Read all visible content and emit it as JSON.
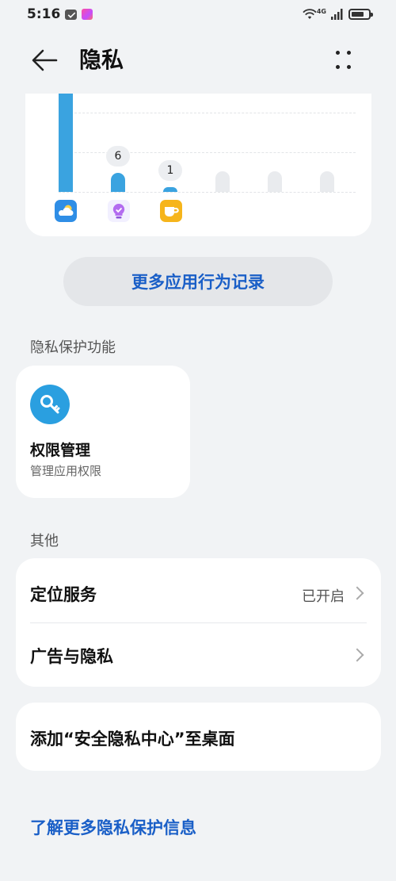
{
  "status_bar": {
    "time": "5:16",
    "network_label": "4G",
    "icons": [
      "notification-icon",
      "app-icon",
      "wifi-icon",
      "signal-icon",
      "battery-icon"
    ]
  },
  "header": {
    "title": "隐私",
    "back_icon": "back-arrow-icon",
    "more_icon": "more-dots-icon"
  },
  "chart_data": {
    "type": "bar",
    "categories": [
      "weather",
      "tips",
      "cup-app",
      "",
      "",
      ""
    ],
    "values": [
      null,
      6,
      1,
      0,
      0,
      0
    ],
    "data_labels": [
      "",
      "6",
      "1",
      "",
      "",
      ""
    ],
    "title": "",
    "xlabel": "",
    "ylabel": "",
    "colors": {
      "bar": "#3aa3e0",
      "empty_bar": "#e9ebee"
    }
  },
  "chart_icons": [
    "weather-app-icon",
    "tips-app-icon",
    "cup-app-icon"
  ],
  "more_records_button": "更多应用行为记录",
  "privacy_section": {
    "title": "隐私保护功能",
    "permission_card": {
      "title": "权限管理",
      "subtitle": "管理应用权限",
      "icon": "key-icon"
    }
  },
  "other_section": {
    "title": "其他",
    "items": [
      {
        "label": "定位服务",
        "value": "已开启"
      },
      {
        "label": "广告与隐私",
        "value": ""
      }
    ]
  },
  "add_to_desktop": "添加“安全隐私中心”至桌面",
  "learn_more_link": "了解更多隐私保护信息",
  "colors": {
    "accent": "#1a5fc7",
    "background": "#f1f3f5",
    "card": "#ffffff"
  }
}
